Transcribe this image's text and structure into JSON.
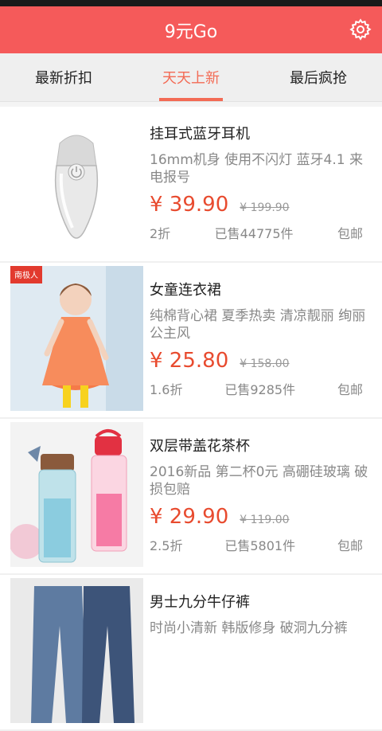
{
  "app": {
    "title": "9元Go"
  },
  "tabs": [
    {
      "label": "最新折扣"
    },
    {
      "label": "天天上新"
    },
    {
      "label": "最后疯抢"
    }
  ],
  "products": [
    {
      "name": "挂耳式蓝牙耳机",
      "desc": "16mm机身 使用不闪灯 蓝牙4.1 来电报号",
      "price": "¥ 39.90",
      "old_price": "¥ 199.90",
      "discount": "2折",
      "sold": "已售44775件",
      "shipping": "包邮"
    },
    {
      "name": "女童连衣裙",
      "desc": "纯棉背心裙 夏季热卖 清凉靓丽 绚丽公主风",
      "price": "¥ 25.80",
      "old_price": "¥ 158.00",
      "discount": "1.6折",
      "sold": "已售9285件",
      "shipping": "包邮",
      "brand_tag": "南极人"
    },
    {
      "name": "双层带盖花茶杯",
      "desc": "2016新品 第二杯0元 高硼硅玻璃 破损包赔",
      "price": "¥ 29.90",
      "old_price": "¥ 119.00",
      "discount": "2.5折",
      "sold": "已售5801件",
      "shipping": "包邮"
    },
    {
      "name": "男士九分牛仔裤",
      "desc": "时尚小清新 韩版修身 破洞九分裤",
      "price": "",
      "old_price": "",
      "discount": "",
      "sold": "",
      "shipping": ""
    }
  ],
  "colors": {
    "accent": "#f55a5a",
    "price": "#e84b2f",
    "tab_active": "#f36b55"
  }
}
